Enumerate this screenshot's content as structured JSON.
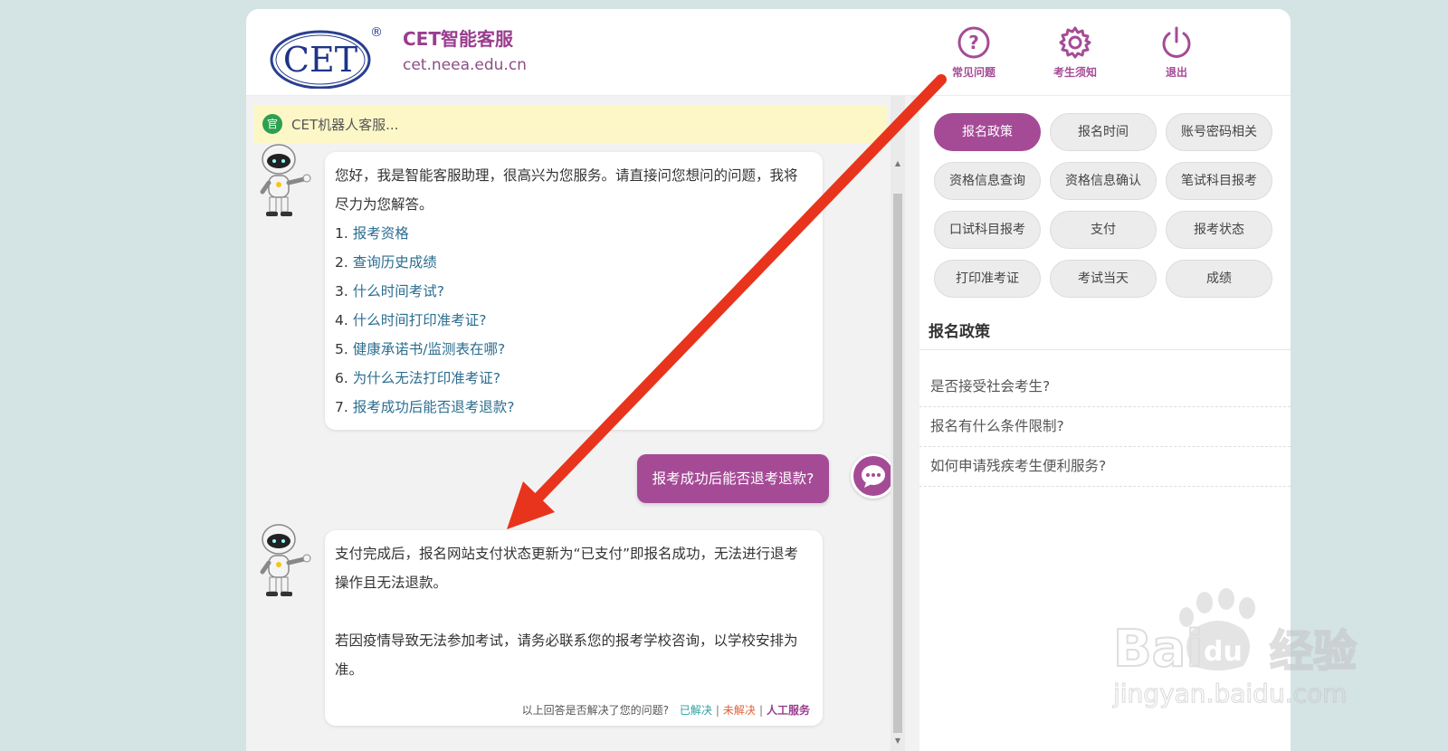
{
  "header": {
    "logo_text": "CET",
    "logo_reg": "®",
    "title": "CET智能客服",
    "url": "cet.neea.edu.cn",
    "buttons": [
      {
        "label": "常见问题",
        "icon": "question-circle-icon"
      },
      {
        "label": "考生须知",
        "icon": "gear-icon"
      },
      {
        "label": "退出",
        "icon": "power-icon"
      }
    ]
  },
  "chat": {
    "notice_badge": "官",
    "notice_text": "CET机器人客服...",
    "greeting": "您好，我是智能客服助理，很高兴为您服务。请直接问您想问的问题，我将尽力为您解答。",
    "questions": [
      {
        "num": "1.",
        "text": "报考资格"
      },
      {
        "num": "2.",
        "text": "查询历史成绩"
      },
      {
        "num": "3.",
        "text": "什么时间考试?"
      },
      {
        "num": "4.",
        "text": "什么时间打印准考证?"
      },
      {
        "num": "5.",
        "text": "健康承诺书/监测表在哪?"
      },
      {
        "num": "6.",
        "text": "为什么无法打印准考证?"
      },
      {
        "num": "7.",
        "text": "报考成功后能否退考退款?"
      }
    ],
    "user_message": "报考成功后能否退考退款?",
    "answer_p1": "支付完成后，报名网站支付状态更新为“已支付”即报名成功，无法进行退考操作且无法退款。",
    "answer_p2": "若因疫情导致无法参加考试，请务必联系您的报考学校咨询，以学校安排为准。",
    "feedback": {
      "prompt": "以上回答是否解决了您的问题?",
      "solved": "已解决",
      "unsolved": "未解决",
      "human": "人工服务",
      "separator": "|"
    }
  },
  "sidebar": {
    "tags": [
      "报名政策",
      "报名时间",
      "账号密码相关",
      "资格信息查询",
      "资格信息确认",
      "笔试科目报考",
      "口试科目报考",
      "支付",
      "报考状态",
      "打印准考证",
      "考试当天",
      "成绩"
    ],
    "active_tag": "报名政策",
    "section_title": "报名政策",
    "faqs": [
      "是否接受社会考生?",
      "报名有什么条件限制?",
      "如何申请残疾考生便利服务?"
    ]
  },
  "watermark": {
    "brand": "Bai",
    "paw_text": "du",
    "cn": "经验",
    "url": "jingyan.baidu.com"
  },
  "colors": {
    "accent": "#a54b96",
    "link": "#2c6e90",
    "annotation_arrow": "#e8341c",
    "notice_bg": "#fdf7c8"
  }
}
